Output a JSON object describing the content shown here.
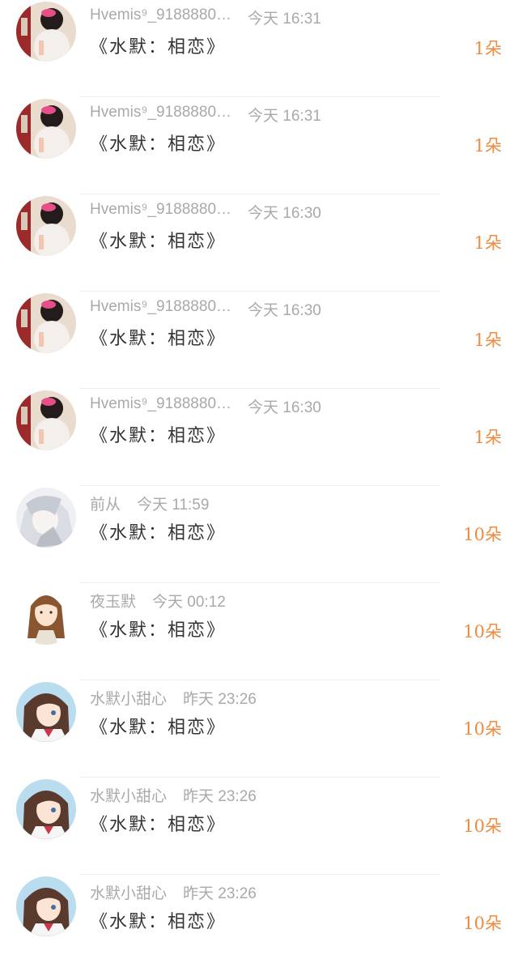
{
  "gift_list": {
    "colors": {
      "accent": "#f08a3c",
      "meta": "#a9a9a9",
      "title": "#333333",
      "divider": "#efefef"
    },
    "items": [
      {
        "name": "Hvemis⁹_9188880",
        "ellipsis": "…",
        "time": "今天 16:31",
        "title": "《水默：相恋》",
        "count": "1朵",
        "avatar": "avatar-girl-pink"
      },
      {
        "name": "Hvemis⁹_9188880",
        "ellipsis": "…",
        "time": "今天 16:31",
        "title": "《水默：相恋》",
        "count": "1朵",
        "avatar": "avatar-girl-pink"
      },
      {
        "name": "Hvemis⁹_9188880",
        "ellipsis": "…",
        "time": "今天 16:30",
        "title": "《水默：相恋》",
        "count": "1朵",
        "avatar": "avatar-girl-pink"
      },
      {
        "name": "Hvemis⁹_9188880",
        "ellipsis": "…",
        "time": "今天 16:30",
        "title": "《水默：相恋》",
        "count": "1朵",
        "avatar": "avatar-girl-pink"
      },
      {
        "name": "Hvemis⁹_9188880",
        "ellipsis": "…",
        "time": "今天 16:30",
        "title": "《水默：相恋》",
        "count": "1朵",
        "avatar": "avatar-girl-pink"
      },
      {
        "name": "前从",
        "ellipsis": "",
        "time": "今天 11:59",
        "title": "《水默：相恋》",
        "count": "10朵",
        "avatar": "avatar-white-hair"
      },
      {
        "name": "夜玉默",
        "ellipsis": "",
        "time": "今天 00:12",
        "title": "《水默：相恋》",
        "count": "10朵",
        "avatar": "avatar-sketch-girl"
      },
      {
        "name": "水默小甜心",
        "ellipsis": "",
        "time": "昨天 23:26",
        "title": "《水默：相恋》",
        "count": "10朵",
        "avatar": "avatar-anime-girl"
      },
      {
        "name": "水默小甜心",
        "ellipsis": "",
        "time": "昨天 23:26",
        "title": "《水默：相恋》",
        "count": "10朵",
        "avatar": "avatar-anime-girl"
      },
      {
        "name": "水默小甜心",
        "ellipsis": "",
        "time": "昨天 23:26",
        "title": "《水默：相恋》",
        "count": "10朵",
        "avatar": "avatar-anime-girl"
      }
    ]
  }
}
